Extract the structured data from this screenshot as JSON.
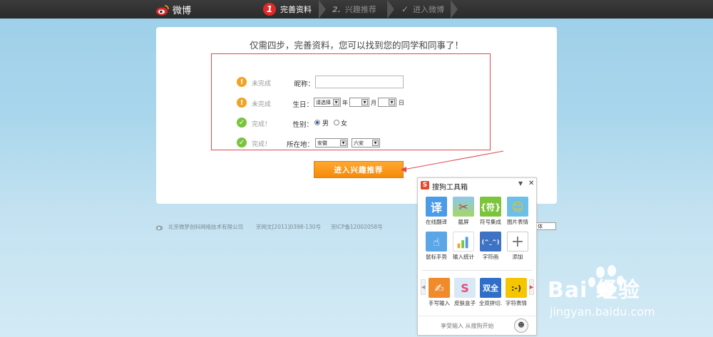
{
  "topbar": {
    "logo_text": "微博",
    "steps": [
      {
        "num": "1",
        "label": "完善资料"
      },
      {
        "num": "2.",
        "label": "兴趣推荐"
      },
      {
        "num": "✓",
        "label": "进入微博"
      }
    ]
  },
  "card": {
    "headline": "仅需四步，完善资料，您可以找到您的同学和同事了！",
    "rows": [
      {
        "status": "未完成",
        "label": "昵称：",
        "value": ""
      },
      {
        "status": "未完成",
        "label": "生日：",
        "select_year": "请选择",
        "unit_year": "年",
        "unit_month": "月",
        "unit_day": "日"
      },
      {
        "status": "完成！",
        "label": "性别：",
        "option_male": "男",
        "option_female": "女",
        "selected": "男"
      },
      {
        "status": "完成！",
        "label": "所在地：",
        "province": "安徽",
        "city": "六安"
      }
    ],
    "next_button": "进入兴趣推荐"
  },
  "footer": {
    "company": "北京微梦创科网络技术有限公司",
    "license1": "京网文[2011]0398-130号",
    "license2": "京ICP备12002058号",
    "lang": "体"
  },
  "sogou_panel": {
    "title": "搜狗工具箱",
    "tools": [
      {
        "label": "在线翻译",
        "glyph": "译",
        "color": "#4a9be8"
      },
      {
        "label": "截屏",
        "glyph": "✂",
        "color": "#8bc34a"
      },
      {
        "label": "符号集成",
        "glyph": "{符}",
        "color": "#7cc43a"
      },
      {
        "label": "图片表情",
        "glyph": "☺",
        "color": "#6cc0e8"
      },
      {
        "label": "鼠标手势",
        "glyph": "☝",
        "color": "#5aa6e6"
      },
      {
        "label": "输入统计",
        "glyph": "▮",
        "color": "#ffffff"
      },
      {
        "label": "字符画",
        "glyph": "(^_^)",
        "color": "#3d72c4"
      },
      {
        "label": "添加",
        "glyph": "+",
        "color": "#ffffff"
      },
      {
        "label": "手写输入",
        "glyph": "✍",
        "color": "#f08a2a"
      },
      {
        "label": "皮肤盒子",
        "glyph": "S",
        "color": "#d8e8f5"
      },
      {
        "label": "全双拼切.",
        "glyph": "双全",
        "color": "#2f6fc9"
      },
      {
        "label": "字符表情",
        "glyph": ":-)",
        "color": "#f5c500"
      }
    ],
    "footer_text": "享受输入 从搜狗开始"
  },
  "watermark": {
    "brand": "Bai  经验",
    "url": "jingyan.baidu.com"
  },
  "colors": {
    "topbar": "#2f2f2f",
    "step_active": "#e02a2a",
    "warn": "#f0a324",
    "ok": "#7ac33f",
    "button": "#f58a0a",
    "annotation": "#e0474e"
  }
}
